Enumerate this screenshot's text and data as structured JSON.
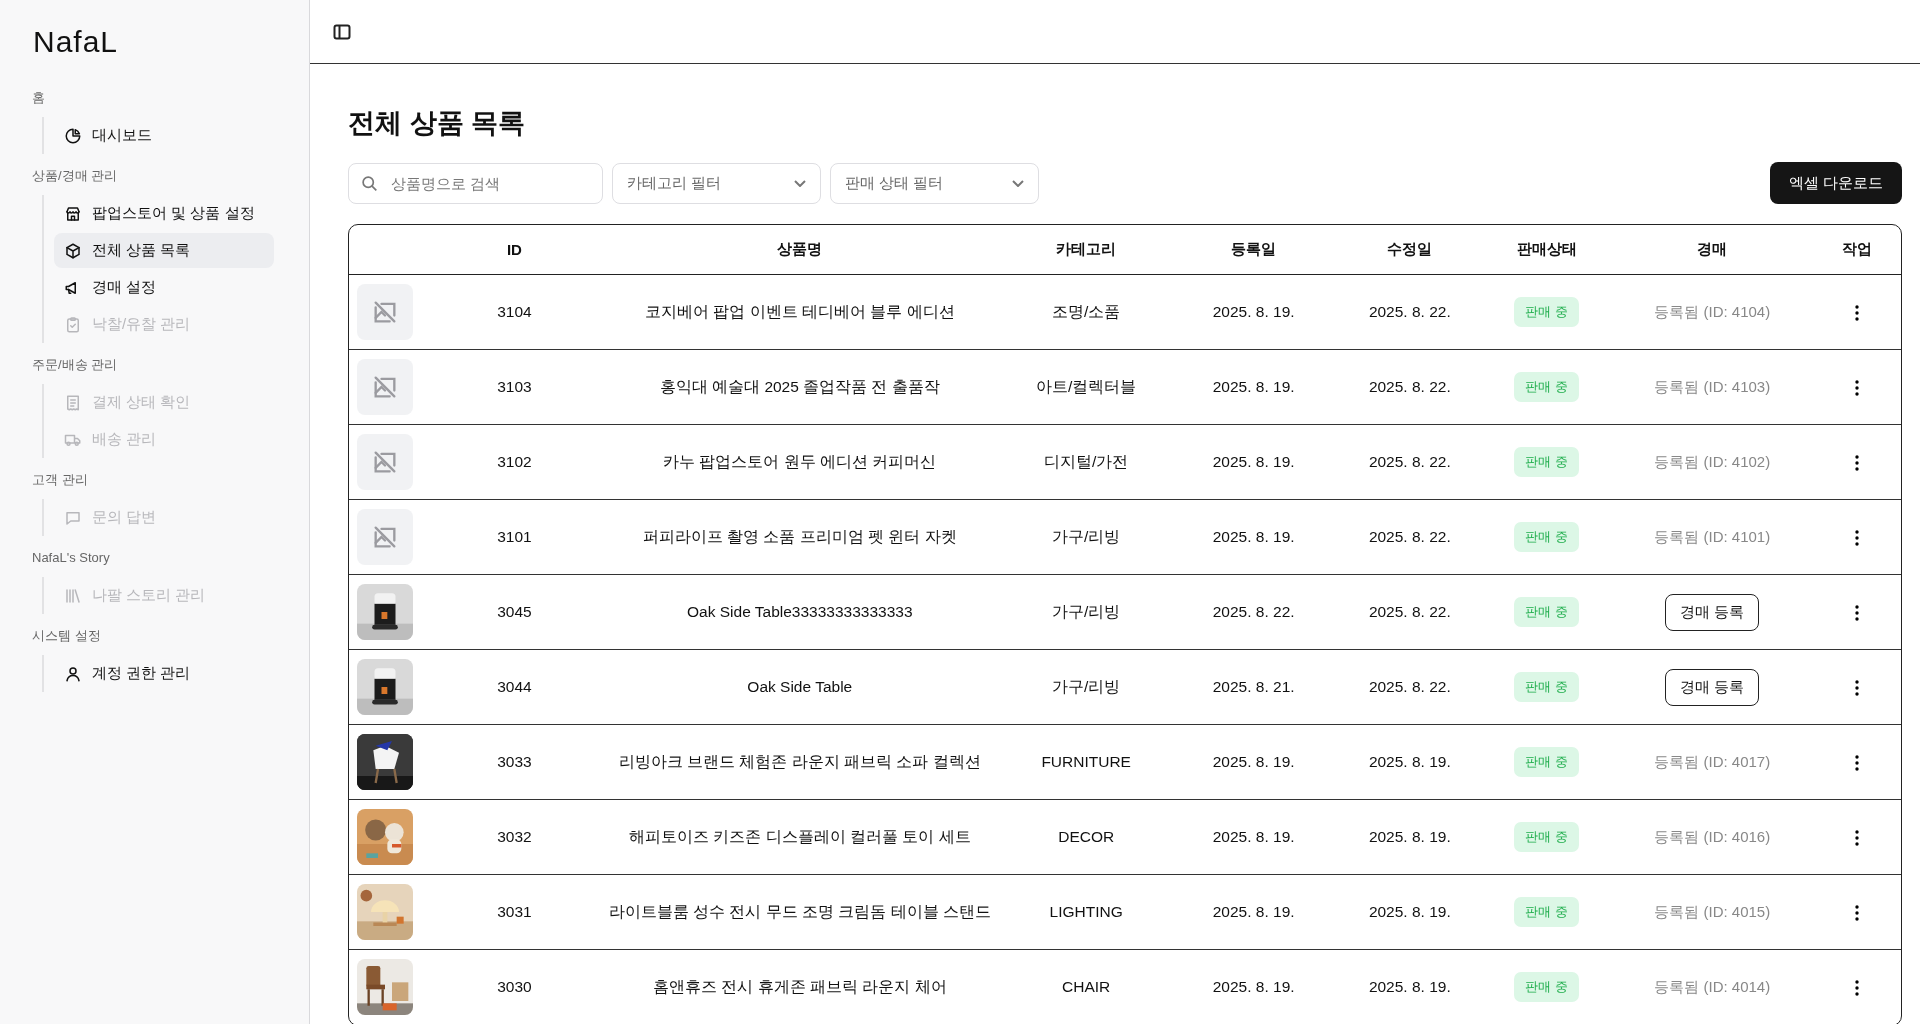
{
  "sidebar": {
    "logo": "NafaL",
    "groups": [
      {
        "label": "홈",
        "items": [
          {
            "label": "대시보드",
            "selected": false,
            "disabled": false
          }
        ]
      },
      {
        "label": "상품/경매 관리",
        "items": [
          {
            "label": "팝업스토어 및 상품 설정",
            "selected": false,
            "disabled": false
          },
          {
            "label": "전체 상품 목록",
            "selected": true,
            "disabled": false
          },
          {
            "label": "경매 설정",
            "selected": false,
            "disabled": false
          },
          {
            "label": "낙찰/유찰 관리",
            "selected": false,
            "disabled": true
          }
        ]
      },
      {
        "label": "주문/배송 관리",
        "items": [
          {
            "label": "결제 상태 확인",
            "selected": false,
            "disabled": true
          },
          {
            "label": "배송 관리",
            "selected": false,
            "disabled": true
          }
        ]
      },
      {
        "label": "고객 관리",
        "items": [
          {
            "label": "문의 답변",
            "selected": false,
            "disabled": true
          }
        ]
      },
      {
        "label": "NafaL's Story",
        "items": [
          {
            "label": "나팔 스토리 관리",
            "selected": false,
            "disabled": true
          }
        ]
      },
      {
        "label": "시스템 설정",
        "items": [
          {
            "label": "계정 권한 관리",
            "selected": false,
            "disabled": false
          }
        ]
      }
    ]
  },
  "page": {
    "title": "전체 상품 목록"
  },
  "filters": {
    "search": {
      "placeholder": "상품명으로 검색"
    },
    "category": {
      "placeholder": "카테고리 필터"
    },
    "status": {
      "placeholder": "판매 상태 필터"
    },
    "export_button": "엑셀 다운로드"
  },
  "table": {
    "columns": [
      "ID",
      "상품명",
      "카테고리",
      "등록일",
      "수정일",
      "판매상태",
      "경매",
      "작업"
    ],
    "rows": [
      {
        "thumb": {
          "kind": "placeholder"
        },
        "id": "3104",
        "name": "코지베어 팝업 이벤트 테디베어 블루 에디션",
        "category": "조명/소품",
        "created": "2025. 8. 19.",
        "updated": "2025. 8. 22.",
        "status": "판매 중",
        "auction": {
          "kind": "registered",
          "text": "등록됨 (ID: 4104)"
        }
      },
      {
        "thumb": {
          "kind": "placeholder"
        },
        "id": "3103",
        "name": "홍익대 예술대 2025 졸업작품 전 출품작",
        "category": "아트/컬렉터블",
        "created": "2025. 8. 19.",
        "updated": "2025. 8. 22.",
        "status": "판매 중",
        "auction": {
          "kind": "registered",
          "text": "등록됨 (ID: 4103)"
        }
      },
      {
        "thumb": {
          "kind": "placeholder"
        },
        "id": "3102",
        "name": "카누 팝업스토어 원두 에디션 커피머신",
        "category": "디지털/가전",
        "created": "2025. 8. 19.",
        "updated": "2025. 8. 22.",
        "status": "판매 중",
        "auction": {
          "kind": "registered",
          "text": "등록됨 (ID: 4102)"
        }
      },
      {
        "thumb": {
          "kind": "placeholder"
        },
        "id": "3101",
        "name": "퍼피라이프 촬영 소품 프리미엄 펫 윈터 자켓",
        "category": "가구/리빙",
        "created": "2025. 8. 19.",
        "updated": "2025. 8. 22.",
        "status": "판매 중",
        "auction": {
          "kind": "registered",
          "text": "등록됨 (ID: 4101)"
        }
      },
      {
        "id": "3045",
        "name": "Oak Side Table33333333333333",
        "category": "가구/리빙",
        "created": "2025. 8. 22.",
        "updated": "2025. 8. 22.",
        "status": "판매 중",
        "auction": {
          "kind": "button",
          "text": "경매 등록"
        }
      },
      {
        "id": "3044",
        "name": "Oak Side Table",
        "category": "가구/리빙",
        "created": "2025. 8. 21.",
        "updated": "2025. 8. 22.",
        "status": "판매 중",
        "auction": {
          "kind": "button",
          "text": "경매 등록"
        }
      },
      {
        "id": "3033",
        "name": "리빙아크 브랜드 체험존 라운지 패브릭 소파 컬렉션",
        "category": "FURNITURE",
        "created": "2025. 8. 19.",
        "updated": "2025. 8. 19.",
        "status": "판매 중",
        "auction": {
          "kind": "registered",
          "text": "등록됨 (ID: 4017)"
        }
      },
      {
        "id": "3032",
        "name": "해피토이즈 키즈존 디스플레이 컬러풀 토이 세트",
        "category": "DECOR",
        "created": "2025. 8. 19.",
        "updated": "2025. 8. 19.",
        "status": "판매 중",
        "auction": {
          "kind": "registered",
          "text": "등록됨 (ID: 4016)"
        }
      },
      {
        "id": "3031",
        "name": "라이트블룸 성수 전시 무드 조명 크림돔 테이블 스탠드",
        "category": "LIGHTING",
        "created": "2025. 8. 19.",
        "updated": "2025. 8. 19.",
        "status": "판매 중",
        "auction": {
          "kind": "registered",
          "text": "등록됨 (ID: 4015)"
        }
      },
      {
        "id": "3030",
        "name": "홈앤휴즈 전시 휴게존 패브릭 라운지 체어",
        "category": "CHAIR",
        "created": "2025. 8. 19.",
        "updated": "2025. 8. 19.",
        "status": "판매 중",
        "auction": {
          "kind": "registered",
          "text": "등록됨 (ID: 4014)"
        }
      }
    ]
  }
}
